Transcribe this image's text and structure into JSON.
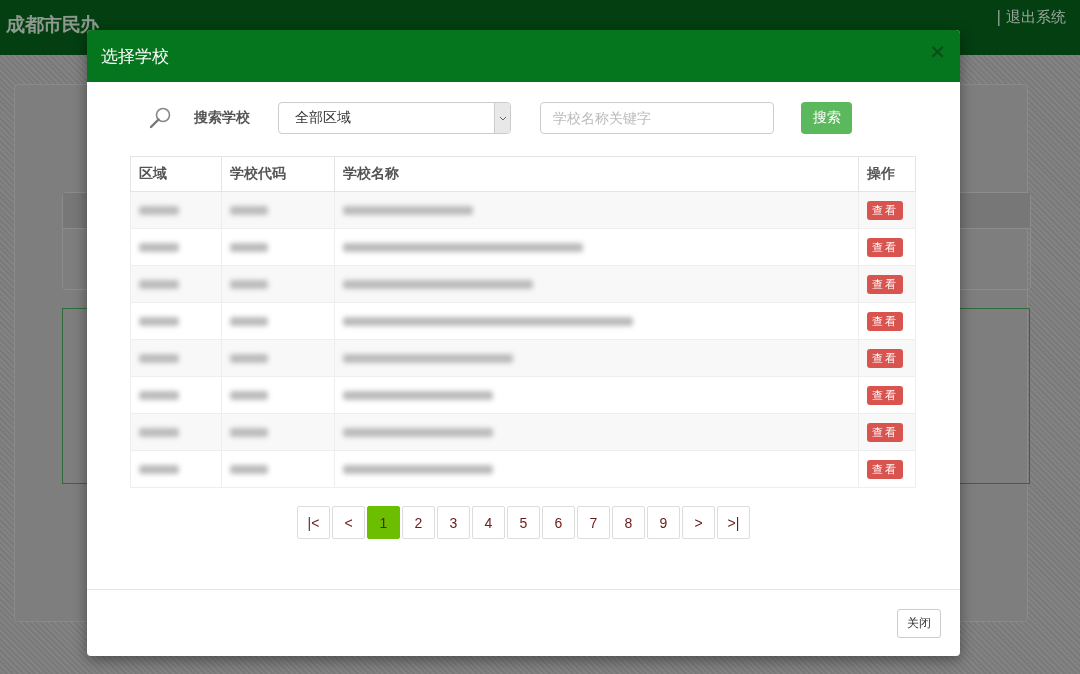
{
  "header": {
    "title": "成都市民办",
    "logout": "| 退出系统"
  },
  "modal": {
    "title": "选择学校",
    "close": "×",
    "search": {
      "label": "搜索学校",
      "region": "全部区域",
      "placeholder": "学校名称关键字",
      "button": "搜索"
    },
    "table": {
      "columns": [
        "区域",
        "学校代码",
        "学校名称",
        "操作"
      ],
      "rows": [
        {
          "action": "查看"
        },
        {
          "action": "查看"
        },
        {
          "action": "查看"
        },
        {
          "action": "查看"
        },
        {
          "action": "查看"
        },
        {
          "action": "查看"
        },
        {
          "action": "查看"
        },
        {
          "action": "查看"
        }
      ]
    },
    "pagination": [
      {
        "label": "|<",
        "selected": false
      },
      {
        "label": "<",
        "selected": false
      },
      {
        "label": "1",
        "selected": true
      },
      {
        "label": "2",
        "selected": false
      },
      {
        "label": "3",
        "selected": false
      },
      {
        "label": "4",
        "selected": false
      },
      {
        "label": "5",
        "selected": false
      },
      {
        "label": "6",
        "selected": false
      },
      {
        "label": "7",
        "selected": false
      },
      {
        "label": "8",
        "selected": false
      },
      {
        "label": "9",
        "selected": false
      },
      {
        "label": ">",
        "selected": false
      },
      {
        "label": ">|",
        "selected": false
      }
    ],
    "footer_button": "关闭"
  }
}
